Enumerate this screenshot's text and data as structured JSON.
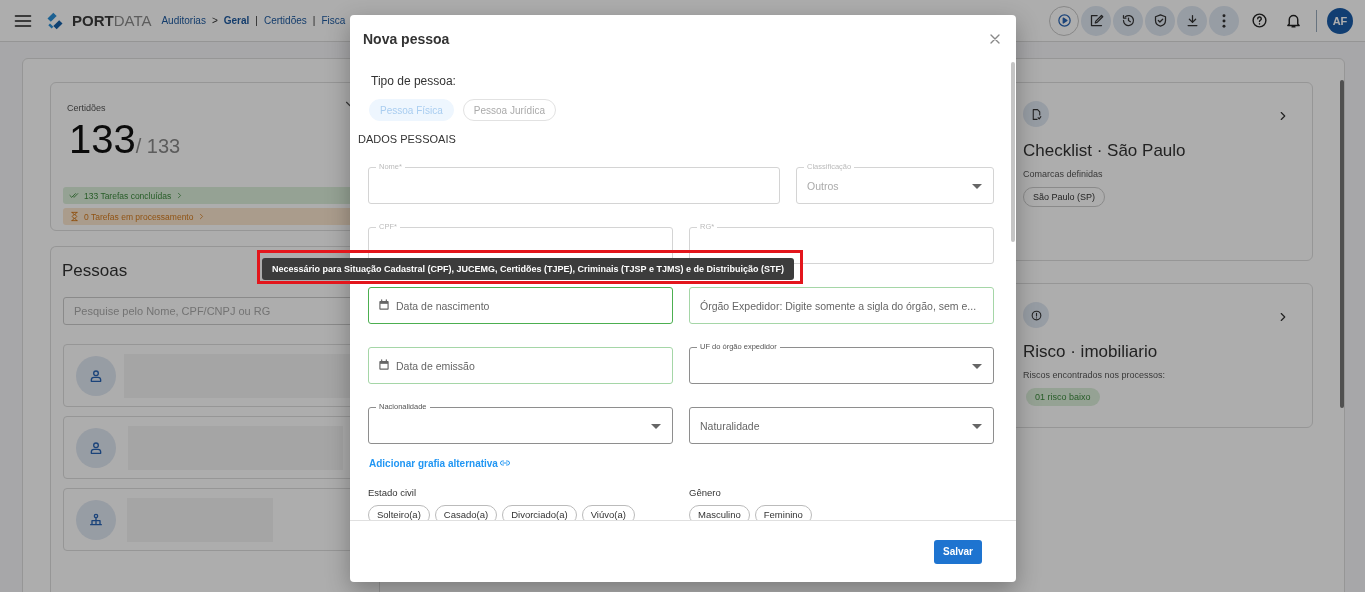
{
  "topbar": {
    "logo": {
      "primary": "PORT",
      "secondary": "DATA"
    },
    "breadcrumb": [
      {
        "label": "Auditorias",
        "kind": "link"
      },
      {
        "label": ">",
        "kind": "separator"
      },
      {
        "label": "Geral",
        "kind": "current"
      },
      {
        "label": "|",
        "kind": "separator"
      },
      {
        "label": "Certidões",
        "kind": "link"
      },
      {
        "label": "|",
        "kind": "separator"
      },
      {
        "label": "Fisca",
        "kind": "link"
      }
    ],
    "avatar": "AF"
  },
  "certidoes": {
    "label": "Certidões",
    "count": "133",
    "total": "/ 133",
    "tasks": [
      {
        "kind": "done",
        "label": "133 Tarefas concluídas"
      },
      {
        "kind": "pending",
        "label": "0 Tarefas em processamento"
      }
    ]
  },
  "people": {
    "title": "Pessoas",
    "search": {
      "placeholder": "Pesquise pelo Nome, CPF/CNPJ ou RG"
    },
    "items": [
      {
        "kind": "person"
      },
      {
        "kind": "person"
      },
      {
        "kind": "company"
      }
    ]
  },
  "cards": [
    {
      "kind": "checklist",
      "title": "Checklist · São Paulo",
      "subtitle": "Comarcas definidas",
      "chip": {
        "kind": "neutral",
        "label": "São Paulo (SP)"
      }
    },
    {
      "kind": "risk",
      "title": "Risco · imobiliario",
      "subtitle": "Riscos encontrados nos processos:",
      "chip": {
        "kind": "low-risk",
        "label": "01 risco baixo"
      }
    }
  ],
  "modal": {
    "title": "Nova pessoa",
    "person_type": {
      "label": "Tipo de pessoa:",
      "options": [
        {
          "label": "Pessoa Física",
          "selected": true,
          "disabled": true
        },
        {
          "label": "Pessoa Jurídica",
          "selected": false,
          "disabled": true
        }
      ]
    },
    "section": "DADOS PESSOAIS",
    "rows": [
      {
        "kind": "wide-narrow",
        "fields": [
          {
            "kind": "text",
            "label": "Nome*",
            "focused": false,
            "valid": false,
            "disabled": true
          },
          {
            "kind": "select",
            "label": "Classificação",
            "value": "Outros",
            "focused": false,
            "valid": false,
            "disabled": true
          }
        ]
      },
      {
        "kind": "even",
        "fields": [
          {
            "kind": "text",
            "label": "CPF*",
            "focused": false,
            "valid": false,
            "disabled": true
          },
          {
            "kind": "text",
            "label": "RG*",
            "focused": false,
            "valid": false,
            "disabled": true
          }
        ]
      },
      {
        "kind": "even",
        "fields": [
          {
            "kind": "date",
            "placeholder": "Data de nascimento",
            "focused": true,
            "valid": true,
            "disabled": false
          },
          {
            "kind": "text",
            "placeholder": "Órgão Expedidor: Digite somente a sigla do órgão, sem e...",
            "focused": false,
            "valid": true,
            "disabled": false
          }
        ]
      },
      {
        "kind": "even",
        "fields": [
          {
            "kind": "date",
            "placeholder": "Data de emissão",
            "focused": false,
            "valid": true,
            "disabled": false
          },
          {
            "kind": "select",
            "label": "UF do órgão expedidor",
            "focused": false,
            "valid": false,
            "disabled": false
          }
        ]
      },
      {
        "kind": "even",
        "fields": [
          {
            "kind": "select",
            "label": "Nacionalidade",
            "focused": false,
            "valid": false,
            "disabled": false
          },
          {
            "kind": "select",
            "placeholder": "Naturalidade",
            "focused": false,
            "valid": false,
            "disabled": false
          }
        ]
      }
    ],
    "link": "Adicionar grafia alternativa",
    "groups": [
      {
        "label": "Estado civil",
        "options": [
          {
            "label": "Solteiro(a)",
            "selected": false
          },
          {
            "label": "Casado(a)",
            "selected": false
          },
          {
            "label": "Divorciado(a)",
            "selected": false
          },
          {
            "label": "Viúvo(a)",
            "selected": false
          }
        ]
      },
      {
        "label": "Gênero",
        "options": [
          {
            "label": "Masculino",
            "selected": false
          },
          {
            "label": "Feminino",
            "selected": false
          }
        ]
      }
    ],
    "save": "Salvar"
  },
  "tooltip": {
    "text": "Necessário para Situação Cadastral (CPF), JUCEMG, Certidões (TJPE), Criminais (TJSP e TJMS) e de Distribuição (STF)"
  }
}
